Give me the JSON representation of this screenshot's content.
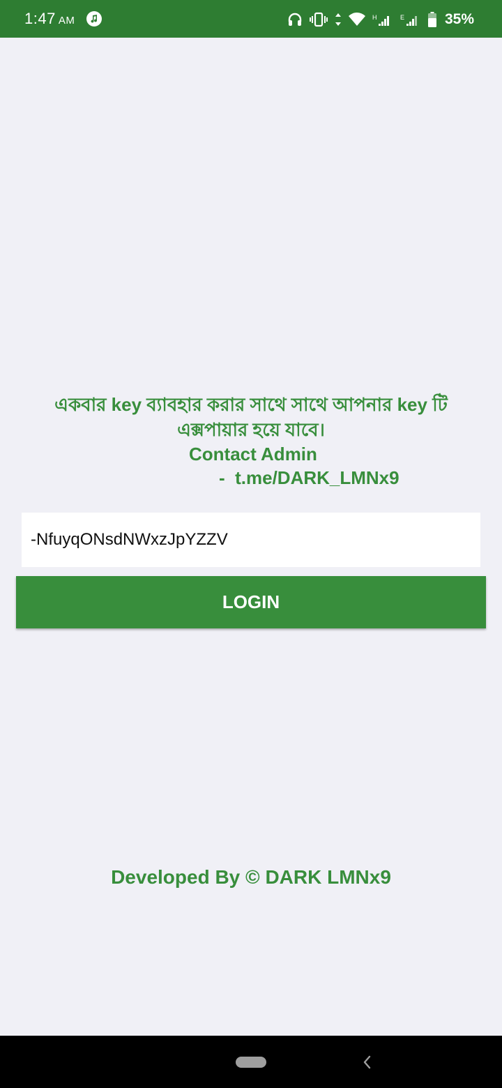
{
  "status_bar": {
    "time": "1:47",
    "ampm": "AM",
    "battery": "35%",
    "icons": [
      "music-icon",
      "headset-icon",
      "vibrate-icon",
      "data-arrows-icon",
      "wifi-icon",
      "signal-h-icon",
      "signal-e-icon",
      "battery-icon"
    ]
  },
  "notice": {
    "line1": "একবার key ব্যাবহার করার সাথে সাথে আপনার key টি",
    "line2": "এক্সপায়ার হয়ে যাবে।",
    "contact": "Contact Admin",
    "link": "-  t.me/DARK_LMNx9"
  },
  "login_form": {
    "key_value": "-NfuyqONsdNWxzJpYZZV",
    "button_label": "LOGIN"
  },
  "footer": {
    "developed_by": "Developed By © DARK LMNx9"
  },
  "colors": {
    "accent": "#388e3c",
    "status_bar": "#2e7d32",
    "background": "#f0f0f6"
  }
}
